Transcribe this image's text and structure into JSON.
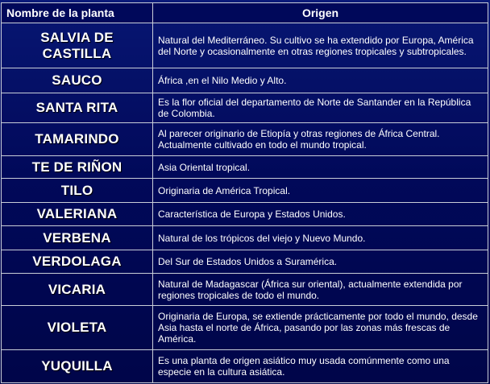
{
  "table": {
    "headers": [
      "Nombre de la planta",
      "Origen"
    ],
    "rows": [
      {
        "name": "SALVIA DE CASTILLA",
        "origin": "Natural del Mediterráneo. Su cultivo se ha extendido por Europa, América del Norte y ocasionalmente en otras regiones tropicales y subtropicales."
      },
      {
        "name": "SAUCO",
        "origin": "África ,en el Nilo Medio y Alto."
      },
      {
        "name": "SANTA RITA",
        "origin": "Es la flor oficial del departamento de Norte de Santander en la República de Colombia."
      },
      {
        "name": "TAMARINDO",
        "origin": "Al parecer originario de Etiopía y otras regiones de África Central. Actualmente cultivado en todo el mundo tropical."
      },
      {
        "name": "TE DE RIÑON",
        "origin": "Asia Oriental tropical."
      },
      {
        "name": "TILO",
        "origin": "Originaria de América Tropical."
      },
      {
        "name": "VALERIANA",
        "origin": "Característica de Europa y Estados Unidos."
      },
      {
        "name": "VERBENA",
        "origin": "Natural de los trópicos del viejo y Nuevo Mundo."
      },
      {
        "name": "VERDOLAGA",
        "origin": "Del Sur de Estados Unidos a Suramérica."
      },
      {
        "name": "VICARIA",
        "origin": "Natural de Madagascar (África sur oriental), actualmente extendida por regiones tropicales de todo el mundo."
      },
      {
        "name": "VIOLETA",
        "origin": "Originaria de Europa, se extiende prácticamente por todo el mundo, desde Asia hasta el norte de África, pasando por las zonas más frescas de América."
      },
      {
        "name": "YUQUILLA",
        "origin": "Es una planta de origen asiático muy usada comúnmente como una especie en la cultura asiática."
      }
    ]
  },
  "colors": {
    "background": "#020a5c",
    "header_background": "#00085a",
    "border": "#c9ced8",
    "text": "#ffffff"
  }
}
